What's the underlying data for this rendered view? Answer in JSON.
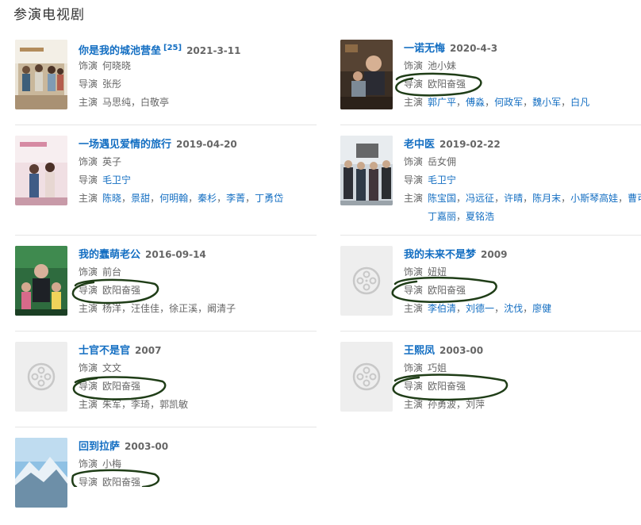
{
  "section_title": "参演电视剧",
  "labels": {
    "role": "饰演",
    "director": "导演",
    "cast": "主演"
  },
  "items": [
    {
      "title": "你是我的城池营垒",
      "sup": "[25]",
      "year": "2021-3-11",
      "role": "何晓晓",
      "director": "张彤",
      "cast": [
        "马思纯",
        "白敬亭"
      ],
      "cast_linked": false
    },
    {
      "title": "一诺无悔",
      "year": "2020-4-3",
      "role": "池小妹",
      "director": "欧阳奋强",
      "cast": [
        "郭广平",
        "傅淼",
        "何政军",
        "魏小军",
        "白凡"
      ],
      "cast_linked": true
    },
    {
      "title": "一场遇见爱情的旅行",
      "year": "2019-04-20",
      "role": "英子",
      "director": "毛卫宁",
      "cast": [
        "陈晓",
        "景甜",
        "何明翰",
        "秦杉",
        "李菁",
        "丁勇岱"
      ],
      "cast_linked": true
    },
    {
      "title": "老中医",
      "year": "2019-02-22",
      "role": "岳女佣",
      "director": "毛卫宁",
      "cast": [
        "陈宝国",
        "冯远征",
        "许晴",
        "陈月末",
        "小斯琴高娃",
        "曹可凡",
        "丁嘉丽",
        "夏铭浩"
      ],
      "cast_linked": true
    },
    {
      "title": "我的蠢萌老公",
      "year": "2016-09-14",
      "role": "前台",
      "director": "欧阳奋强",
      "cast": [
        "杨洋",
        "汪佳佳",
        "徐正溪",
        "阚清子"
      ],
      "cast_linked": false
    },
    {
      "title": "我的未来不是梦",
      "year": "2009",
      "role": "妞妞",
      "director": "欧阳奋强",
      "cast": [
        "李伯清",
        "刘德一",
        "沈伐",
        "廖健"
      ],
      "cast_linked": true
    },
    {
      "title": "士官不是官",
      "year": "2007",
      "role": "文文",
      "director": "欧阳奋强",
      "cast": [
        "朱军",
        "李琦",
        "郭凯敏"
      ],
      "cast_linked": false
    },
    {
      "title": "王熙凤",
      "year": "2003-00",
      "role": "巧姐",
      "director": "欧阳奋强",
      "cast": [
        "孙勇波",
        "刘萍"
      ],
      "cast_linked": false
    },
    {
      "title": "回到拉萨",
      "year": "2003-00",
      "role": "小梅",
      "director": "欧阳奋强",
      "cast": [],
      "cast_linked": false
    }
  ],
  "colors": {
    "link": "#136ec2",
    "text": "#666666",
    "scribble": "#1f3d17",
    "placeholder": "#eeeeee"
  },
  "icons": {
    "placeholder": "film-reel-icon"
  }
}
